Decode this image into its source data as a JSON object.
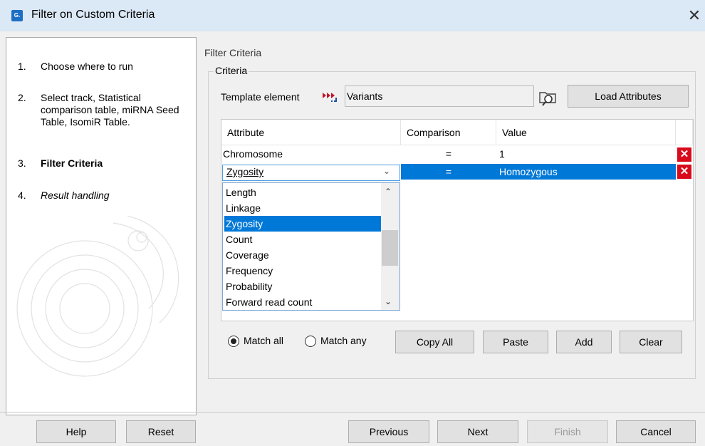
{
  "window": {
    "title": "Filter on Custom Criteria",
    "close_glyph": "✕",
    "app_icon_text": "G."
  },
  "steps": [
    {
      "num": "1.",
      "label": "Choose where to run",
      "style": "normal"
    },
    {
      "num": "2.",
      "label": "Select track, Statistical comparison table, miRNA Seed Table, IsomiR Table.",
      "style": "normal"
    },
    {
      "num": "3.",
      "label": "Filter Criteria",
      "style": "bold"
    },
    {
      "num": "4.",
      "label": "Result handling",
      "style": "italic"
    }
  ],
  "panel": {
    "heading": "Filter Criteria",
    "group_label": "Criteria",
    "template_label": "Template element",
    "template_value": "Variants",
    "load_attributes": "Load Attributes"
  },
  "table": {
    "headers": [
      "Attribute",
      "Comparison",
      "Value"
    ],
    "rows": [
      {
        "attribute": "Chromosome",
        "comparison": "=",
        "value": "1"
      },
      {
        "attribute": "Zygosity",
        "comparison": "=",
        "value": "Homozygous"
      }
    ],
    "delete_glyph": "✕"
  },
  "dropdown": {
    "selected": "Zygosity",
    "options": [
      "Length",
      "Linkage",
      "Zygosity",
      "Count",
      "Coverage",
      "Frequency",
      "Probability",
      "Forward read count"
    ],
    "highlighted": "Zygosity"
  },
  "match": {
    "all_label": "Match all",
    "any_label": "Match any",
    "selected": "all"
  },
  "actions": {
    "copy_all": "Copy All",
    "paste": "Paste",
    "add": "Add",
    "clear": "Clear"
  },
  "footer": {
    "help": "Help",
    "reset": "Reset",
    "previous": "Previous",
    "next": "Next",
    "finish": "Finish",
    "cancel": "Cancel"
  },
  "colors": {
    "accent": "#0078d7",
    "delete": "#d90a1b",
    "titlebar": "#dbe8f6"
  }
}
